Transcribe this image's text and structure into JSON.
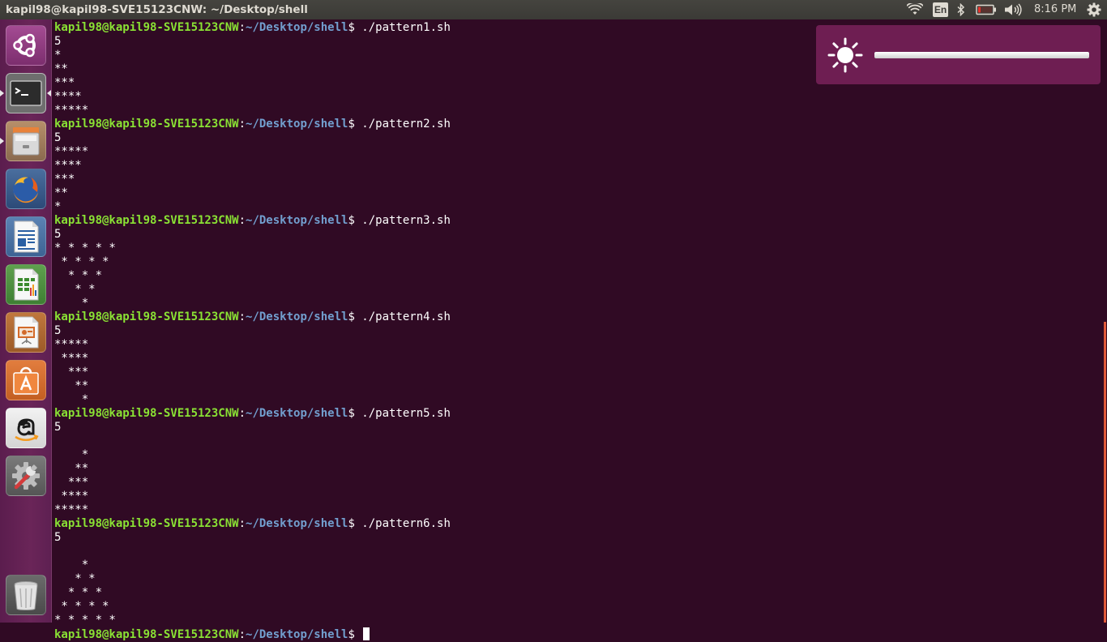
{
  "topbar": {
    "window_title": "kapil98@kapil98-SVE15123CNW: ~/Desktop/shell",
    "language": "En",
    "clock": "8:16 PM",
    "indicators": [
      "wifi-icon",
      "keyboard-language-indicator",
      "bluetooth-icon",
      "battery-icon",
      "volume-icon",
      "clock",
      "settings-gear-icon"
    ]
  },
  "launcher": {
    "items": [
      {
        "name": "ubuntu-dash",
        "icon": "ubuntu-logo-icon"
      },
      {
        "name": "terminal",
        "icon": "terminal-icon",
        "running": true,
        "focused": true
      },
      {
        "name": "files",
        "icon": "file-cabinet-icon",
        "running": true
      },
      {
        "name": "firefox",
        "icon": "firefox-icon"
      },
      {
        "name": "libreoffice-writer",
        "icon": "writer-document-icon"
      },
      {
        "name": "libreoffice-calc",
        "icon": "calc-spreadsheet-icon"
      },
      {
        "name": "libreoffice-impress",
        "icon": "impress-presentation-icon"
      },
      {
        "name": "ubuntu-software",
        "icon": "software-bag-icon"
      },
      {
        "name": "amazon",
        "icon": "amazon-icon"
      },
      {
        "name": "system-settings",
        "icon": "settings-tools-icon"
      },
      {
        "name": "trash",
        "icon": "trash-icon"
      }
    ]
  },
  "terminal": {
    "prompt_user": "kapil98@kapil98-SVE15123CNW",
    "prompt_sep": ":",
    "prompt_path": "~/Desktop/shell",
    "prompt_end": "$ ",
    "sessions": [
      {
        "command": "./pattern1.sh",
        "output": "5\n*\n**\n***\n****\n*****"
      },
      {
        "command": "./pattern2.sh",
        "output": "5\n*****\n****\n***\n**\n*"
      },
      {
        "command": "./pattern3.sh",
        "output": "5\n* * * * *\n * * * *\n  * * *\n   * *\n    *"
      },
      {
        "command": "./pattern4.sh",
        "output": "5\n*****\n ****\n  ***\n   **\n    *"
      },
      {
        "command": "./pattern5.sh",
        "output": "5\n\n    *\n   **\n  ***\n ****\n*****"
      },
      {
        "command": "./pattern6.sh",
        "output": "5\n\n    *\n   * *\n  * * *\n * * * *\n* * * * *"
      }
    ]
  },
  "brightness_osd": {
    "icon": "brightness-sun-icon",
    "level": 1.0
  },
  "colors": {
    "terminal_bg": "#300a24",
    "prompt_user": "#8ae234",
    "prompt_path": "#729fcf",
    "osd_bg": "#6e1e52",
    "launcher_bg": "#5e2052",
    "panel_bg": "#3b3a36"
  }
}
